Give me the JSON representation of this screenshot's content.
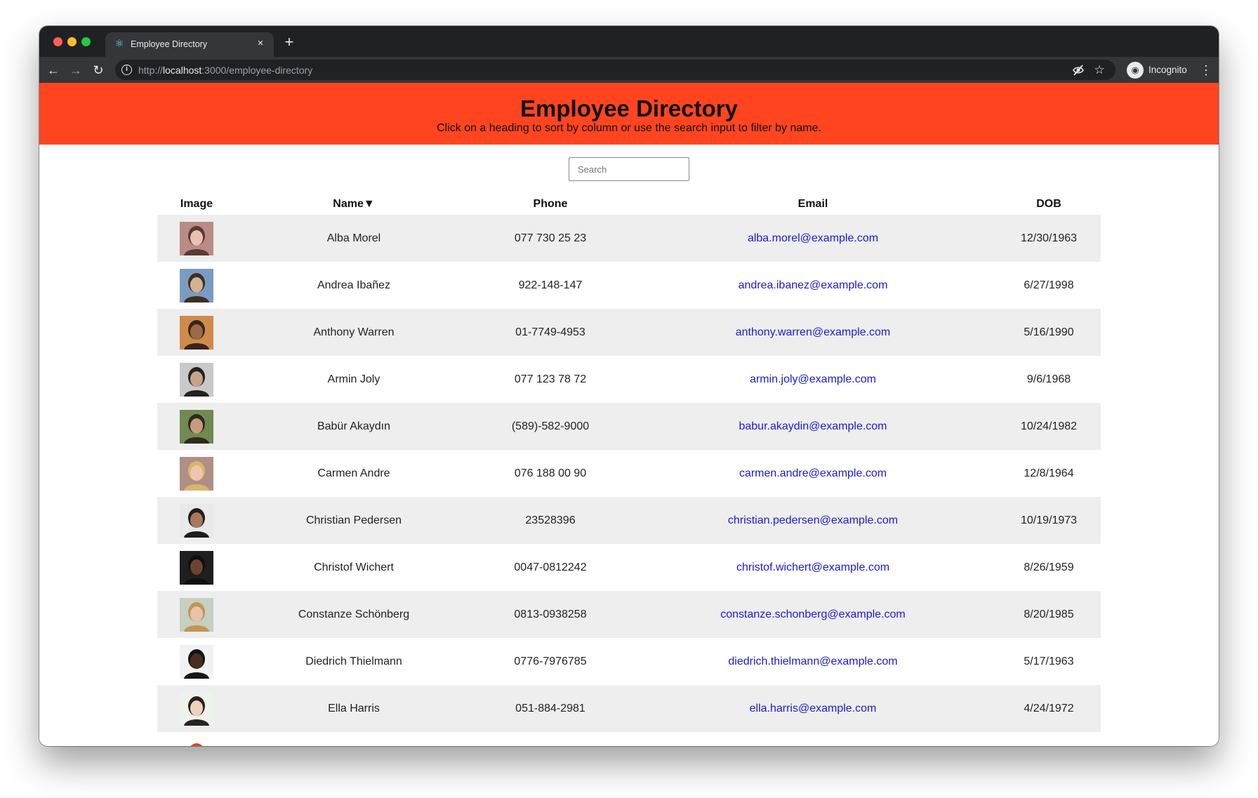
{
  "browser": {
    "tab_title": "Employee Directory",
    "tab_icon": "react-logo-icon",
    "url_scheme": "http://",
    "url_host": "localhost",
    "url_path": ":3000/employee-directory",
    "profile_label": "Incognito"
  },
  "header": {
    "title": "Employee Directory",
    "subtitle": "Click on a heading to sort by column or use the search input to filter by name.",
    "color": "#ff4520"
  },
  "search": {
    "placeholder": "Search",
    "value": ""
  },
  "table": {
    "columns": [
      "Image",
      "Name▼",
      "Phone",
      "Email",
      "DOB"
    ],
    "link_color": "#1a1ad6",
    "stripe_color": "#eeeeee",
    "rows": [
      {
        "name": "Alba Morel",
        "phone": "077 730 25 23",
        "email": "alba.morel@example.com",
        "dob": "12/30/1963"
      },
      {
        "name": "Andrea Ibañez",
        "phone": "922-148-147",
        "email": "andrea.ibanez@example.com",
        "dob": "6/27/1998"
      },
      {
        "name": "Anthony Warren",
        "phone": "01-7749-4953",
        "email": "anthony.warren@example.com",
        "dob": "5/16/1990"
      },
      {
        "name": "Armin Joly",
        "phone": "077 123 78 72",
        "email": "armin.joly@example.com",
        "dob": "9/6/1968"
      },
      {
        "name": "Babür Akaydın",
        "phone": "(589)-582-9000",
        "email": "babur.akaydin@example.com",
        "dob": "10/24/1982"
      },
      {
        "name": "Carmen Andre",
        "phone": "076 188 00 90",
        "email": "carmen.andre@example.com",
        "dob": "12/8/1964"
      },
      {
        "name": "Christian Pedersen",
        "phone": "23528396",
        "email": "christian.pedersen@example.com",
        "dob": "10/19/1973"
      },
      {
        "name": "Christof Wichert",
        "phone": "0047-0812242",
        "email": "christof.wichert@example.com",
        "dob": "8/26/1959"
      },
      {
        "name": "Constanze Schönberg",
        "phone": "0813-0938258",
        "email": "constanze.schonberg@example.com",
        "dob": "8/20/1985"
      },
      {
        "name": "Diedrich Thielmann",
        "phone": "0776-7976785",
        "email": "diedrich.thielmann@example.com",
        "dob": "5/17/1963"
      },
      {
        "name": "Ella Harris",
        "phone": "051-884-2981",
        "email": "ella.harris@example.com",
        "dob": "4/24/1972"
      },
      {
        "name": "",
        "phone": "",
        "email": "",
        "dob": ""
      }
    ]
  }
}
